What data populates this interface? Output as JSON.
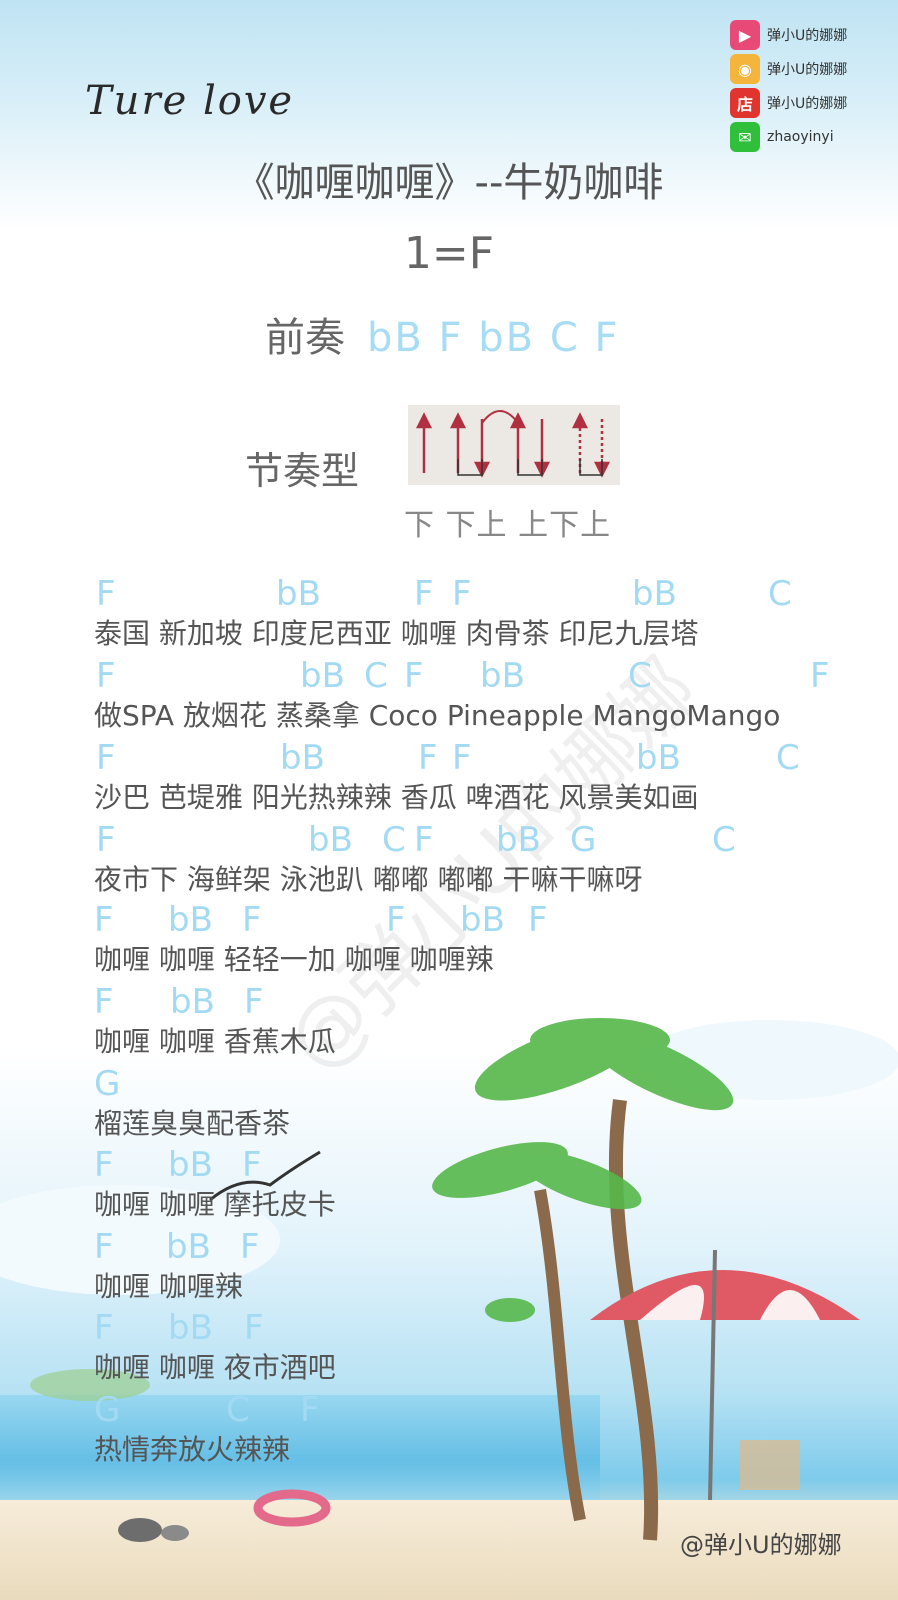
{
  "colors": {
    "chord": "#a3daf3",
    "lyric": "#555555",
    "title": "#555555"
  },
  "social": [
    {
      "icon": "video-icon",
      "text": "弹小U的娜娜",
      "color": "#e84a78"
    },
    {
      "icon": "weibo-icon",
      "text": "弹小U的娜娜",
      "color": "#f5b53d"
    },
    {
      "icon": "shop-icon",
      "text": "弹小U的娜娜",
      "color": "#e2342e"
    },
    {
      "icon": "wechat-icon",
      "text": "zhaoyinyi",
      "color": "#2fbf3a"
    }
  ],
  "script_title": "Ture love",
  "title": "《咖喱咖喱》--牛奶咖啡",
  "key": "1=F",
  "prelude": {
    "label": "前奏",
    "chords": "bB F  bB C F"
  },
  "rhythm": {
    "label": "节奏型",
    "strum": "下 下上 上下上"
  },
  "verses": [
    {
      "lyric": "泰国 新加坡 印度尼西亚 咖喱 肉骨茶 印尼九层塔",
      "chords": [
        {
          "c": "F"
        },
        {
          "c": "bB"
        },
        {
          "c": "F"
        },
        {
          "c": "F"
        },
        {
          "c": "bB"
        },
        {
          "c": "C"
        }
      ]
    },
    {
      "lyric": "做SPA 放烟花 蒸桑拿 Coco Pineapple MangoMango",
      "chords": [
        {
          "c": "F"
        },
        {
          "c": "bB"
        },
        {
          "c": "C"
        },
        {
          "c": "F"
        },
        {
          "c": "bB"
        },
        {
          "c": "C"
        },
        {
          "c": "F"
        }
      ]
    },
    {
      "lyric": "沙巴 芭堤雅 阳光热辣辣 香瓜 啤酒花 风景美如画",
      "chords": [
        {
          "c": "F"
        },
        {
          "c": "bB"
        },
        {
          "c": "F"
        },
        {
          "c": "F"
        },
        {
          "c": "bB"
        },
        {
          "c": "C"
        }
      ]
    },
    {
      "lyric": "夜市下 海鲜架 泳池趴 嘟嘟 嘟嘟 干嘛干嘛呀",
      "chords": [
        {
          "c": "F"
        },
        {
          "c": "bB"
        },
        {
          "c": "C"
        },
        {
          "c": "F"
        },
        {
          "c": "bB"
        },
        {
          "c": "G"
        },
        {
          "c": "C"
        }
      ]
    },
    {
      "lyric": "咖喱 咖喱 轻轻一加 咖喱 咖喱辣",
      "chords": [
        {
          "c": "F"
        },
        {
          "c": "bB"
        },
        {
          "c": "F"
        },
        {
          "c": "F"
        },
        {
          "c": "bB"
        },
        {
          "c": "F"
        }
      ]
    },
    {
      "lyric": "咖喱 咖喱 香蕉木瓜",
      "chords": [
        {
          "c": "F"
        },
        {
          "c": "bB"
        },
        {
          "c": "F"
        }
      ]
    },
    {
      "lyric": "榴莲臭臭配香茶",
      "chords": [
        {
          "c": "G"
        }
      ]
    },
    {
      "lyric": "咖喱 咖喱 摩托皮卡",
      "chords": [
        {
          "c": "F"
        },
        {
          "c": "bB"
        },
        {
          "c": "F"
        }
      ]
    },
    {
      "lyric": "咖喱 咖喱辣",
      "chords": [
        {
          "c": "F"
        },
        {
          "c": "bB"
        },
        {
          "c": "F"
        }
      ]
    },
    {
      "lyric": "咖喱 咖喱 夜市酒吧",
      "chords": [
        {
          "c": "F"
        },
        {
          "c": "bB"
        },
        {
          "c": "F"
        }
      ]
    },
    {
      "lyric": "热情奔放火辣辣",
      "chords": [
        {
          "c": "G"
        },
        {
          "c": "C"
        },
        {
          "c": "F"
        }
      ]
    }
  ],
  "watermark": "@弹小U的娜娜",
  "diagonal_watermark": "@弹小U的娜娜"
}
